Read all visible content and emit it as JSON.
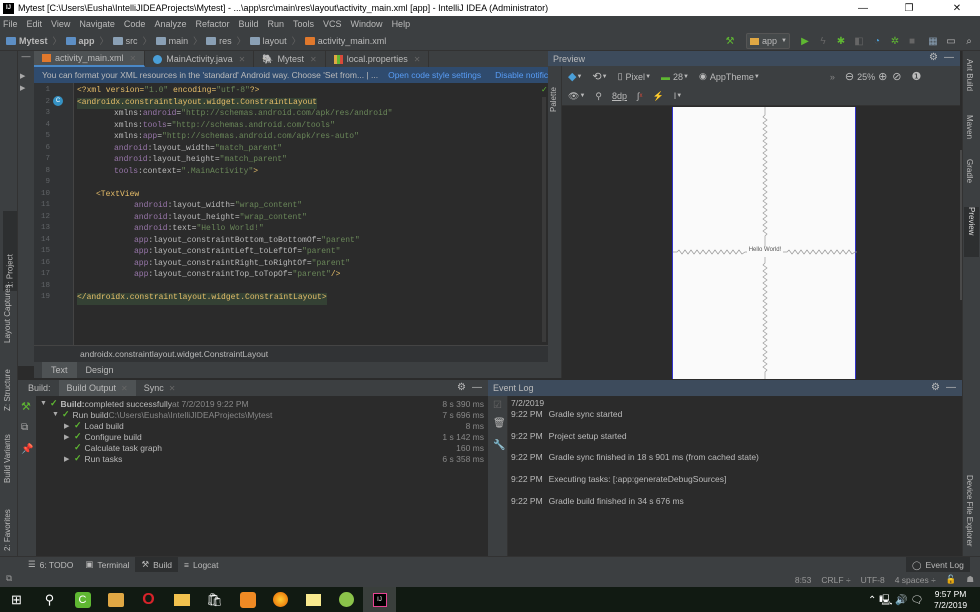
{
  "window": {
    "title": "Mytest [C:\\Users\\Eusha\\IntelliJIDEAProjects\\Mytest] - ...\\app\\src\\main\\res\\layout\\activity_main.xml [app] - IntelliJ IDEA (Administrator)",
    "app_icon": "IJ",
    "controls": {
      "minimize": "—",
      "restore": "❐",
      "close": "✕"
    }
  },
  "menu": [
    "File",
    "Edit",
    "View",
    "Navigate",
    "Code",
    "Analyze",
    "Refactor",
    "Build",
    "Run",
    "Tools",
    "VCS",
    "Window",
    "Help"
  ],
  "breadcrumbs": [
    "Mytest",
    "app",
    "src",
    "main",
    "res",
    "layout",
    "activity_main.xml"
  ],
  "toolbar": {
    "run_config": "app"
  },
  "editor": {
    "tabs": [
      {
        "label": "activity_main.xml",
        "active": true
      },
      {
        "label": "MainActivity.java",
        "active": false
      },
      {
        "label": "Mytest",
        "active": false
      },
      {
        "label": "local.properties",
        "active": false
      }
    ],
    "notification": {
      "text": "You can format your XML resources in the 'standard' Android way. Choose 'Set from... | ...",
      "link1": "Open code style settings",
      "link2": "Disable notification"
    },
    "line_numbers": [
      "1",
      "2",
      "3",
      "4",
      "5",
      "6",
      "7",
      "8",
      "9",
      "10",
      "11",
      "12",
      "13",
      "14",
      "15",
      "16",
      "17",
      "18",
      "19"
    ],
    "code": {
      "l1": {
        "a": "<?xml version=",
        "b": "\"1.0\"",
        "c": " encoding=",
        "d": "\"utf-8\"",
        "e": "?>"
      },
      "l2": "<androidx.constraintlayout.widget.ConstraintLayout",
      "l3": {
        "ns": "xmlns:",
        "p": "android",
        "eq": "=",
        "v": "\"http://schemas.android.com/apk/res/android\""
      },
      "l4": {
        "ns": "xmlns:",
        "p": "tools",
        "eq": "=",
        "v": "\"http://schemas.android.com/tools\""
      },
      "l5": {
        "ns": "xmlns:",
        "p": "app",
        "eq": "=",
        "v": "\"http://schemas.android.com/apk/res-auto\""
      },
      "l6": {
        "p": "android",
        "a": ":layout_width",
        "eq": "=",
        "v": "\"match_parent\""
      },
      "l7": {
        "p": "android",
        "a": ":layout_height",
        "eq": "=",
        "v": "\"match_parent\""
      },
      "l8": {
        "p": "tools",
        "a": ":context",
        "eq": "=",
        "v": "\".MainActivity\"",
        "end": ">"
      },
      "l10": "<TextView",
      "l11": {
        "p": "android",
        "a": ":layout_width",
        "eq": "=",
        "v": "\"wrap_content\""
      },
      "l12": {
        "p": "android",
        "a": ":layout_height",
        "eq": "=",
        "v": "\"wrap_content\""
      },
      "l13": {
        "p": "android",
        "a": ":text",
        "eq": "=",
        "v": "\"Hello World!\""
      },
      "l14": {
        "p": "app",
        "a": ":layout_constraintBottom_toBottomOf",
        "eq": "=",
        "v": "\"parent\""
      },
      "l15": {
        "p": "app",
        "a": ":layout_constraintLeft_toLeftOf",
        "eq": "=",
        "v": "\"parent\""
      },
      "l16": {
        "p": "app",
        "a": ":layout_constraintRight_toRightOf",
        "eq": "=",
        "v": "\"parent\""
      },
      "l17": {
        "p": "app",
        "a": ":layout_constraintTop_toTopOf",
        "eq": "=",
        "v": "\"parent\"",
        "end": "/>"
      },
      "l19": "</androidx.constraintlayout.widget.ConstraintLayout>"
    },
    "breadcrumb_bottom": "androidx.constraintlayout.widget.ConstraintLayout",
    "mode_tabs": [
      "Text",
      "Design"
    ]
  },
  "preview": {
    "title": "Preview",
    "device": "Pixel",
    "api": "28",
    "theme": "AppTheme",
    "zoom": "25%",
    "margin": "8dp",
    "hello_text": "Hello World!"
  },
  "left_tool_windows": [
    "1: Project",
    "Layout Captures",
    "Z: Structure",
    "Build Variants",
    "2: Favorites"
  ],
  "right_tool_windows": [
    "Ant Build",
    "Maven",
    "Gradle",
    "Preview",
    "Device File Explorer"
  ],
  "palette_label": "Palette",
  "build": {
    "label": "Build:",
    "tabs": [
      "Build Output",
      "Sync"
    ],
    "rows": [
      {
        "bold": "Build:",
        "text": " completed successfully",
        "dim": " at 7/2/2019 9:22 PM",
        "time": "8 s 390 ms",
        "level": 0,
        "arrow": "▼"
      },
      {
        "bold": "",
        "text": "Run build",
        "dim": " C:\\Users\\Eusha\\IntelliJIDEAProjects\\Mytest",
        "time": "7 s 696 ms",
        "level": 1,
        "arrow": "▼"
      },
      {
        "bold": "",
        "text": "Load build",
        "dim": "",
        "time": "8 ms",
        "level": 2,
        "arrow": "▶"
      },
      {
        "bold": "",
        "text": "Configure build",
        "dim": "",
        "time": "1 s 142 ms",
        "level": 2,
        "arrow": "▶"
      },
      {
        "bold": "",
        "text": "Calculate task graph",
        "dim": "",
        "time": "160 ms",
        "level": 2,
        "arrow": ""
      },
      {
        "bold": "",
        "text": "Run tasks",
        "dim": "",
        "time": "6 s 358 ms",
        "level": 2,
        "arrow": "▶"
      }
    ]
  },
  "event_log": {
    "title": "Event Log",
    "date": "7/2/2019",
    "entries": [
      {
        "time": "9:22 PM",
        "msg": "Gradle sync started"
      },
      {
        "time": "9:22 PM",
        "msg": "Project setup started"
      },
      {
        "time": "9:22 PM",
        "msg": "Gradle sync finished in 18 s 901 ms (from cached state)"
      },
      {
        "time": "9:22 PM",
        "msg": "Executing tasks: [:app:generateDebugSources]"
      },
      {
        "time": "9:22 PM",
        "msg": "Gradle build finished in 34 s 676 ms"
      }
    ]
  },
  "bottom_tabs": [
    "6: TODO",
    "Terminal",
    "Build",
    "Logcat"
  ],
  "bottom_right_tab": "Event Log",
  "status": {
    "position": "8:53",
    "line_sep": "CRLF ÷",
    "encoding": "UTF-8",
    "indent": "4 spaces ÷"
  },
  "taskbar": {
    "time": "9:57 PM",
    "date": "7/2/2019"
  }
}
